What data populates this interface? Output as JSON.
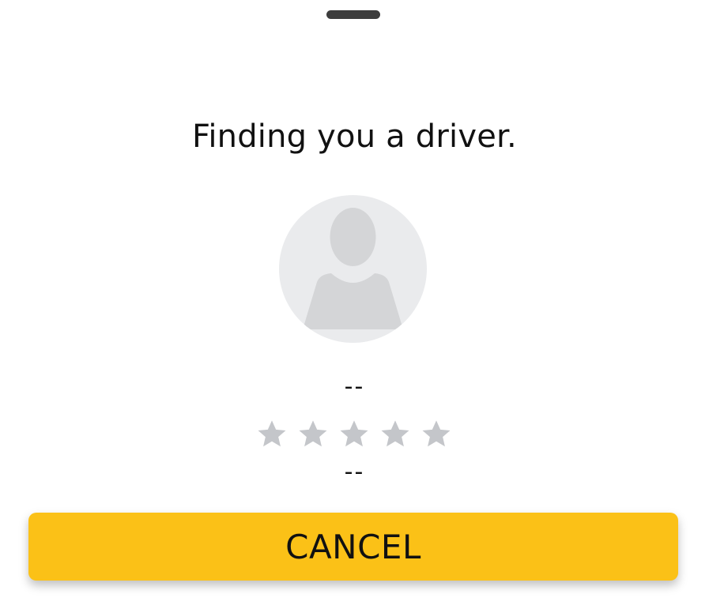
{
  "sheet": {
    "title": "Finding you a driver.",
    "driver_name": "--",
    "vehicle_info": "--",
    "rating": {
      "stars_total": 5,
      "stars_filled": 0,
      "star_color": "#c4c6ca"
    },
    "avatar": {
      "icon": "person-placeholder-icon",
      "background": "#eaebed",
      "silhouette_color": "#d4d5d7"
    }
  },
  "actions": {
    "cancel_label": "CANCEL",
    "cancel_color": "#fbc117"
  }
}
